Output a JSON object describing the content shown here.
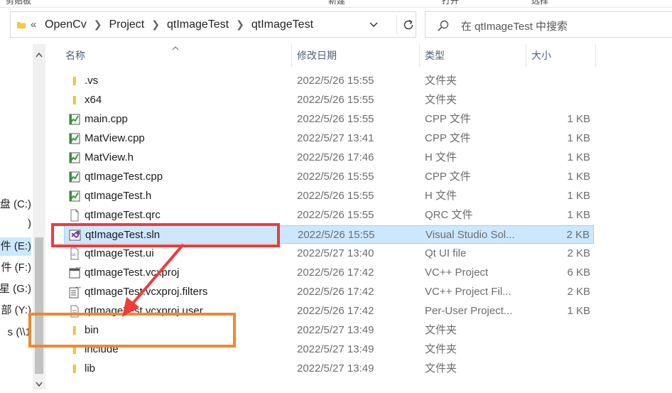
{
  "ribbon": {
    "labels": [
      "剪贴板",
      "新建",
      "打开",
      "选择"
    ]
  },
  "address_bar": {
    "overflow": "«",
    "breadcrumbs": [
      "OpenCv",
      "Project",
      "qtImageTest",
      "qtImageTest"
    ]
  },
  "search": {
    "placeholder": "在 qtImageTest 中搜索"
  },
  "nav": {
    "items": [
      {
        "label": "盘 (C:)"
      },
      {
        "label": ")"
      },
      {
        "label": "件 (E:)",
        "selected": true
      },
      {
        "label": "件 (F:)"
      },
      {
        "label": "星 (G:)"
      },
      {
        "label": "部 (Y:)"
      },
      {
        "label": "s (\\\\1"
      }
    ]
  },
  "columns": {
    "name": "名称",
    "date": "修改日期",
    "type": "类型",
    "size": "大小"
  },
  "files": [
    {
      "name": ".vs",
      "date": "2022/5/26 15:55",
      "type": "文件夹",
      "size": "",
      "icon": "folder-icon"
    },
    {
      "name": "x64",
      "date": "2022/5/26 15:55",
      "type": "文件夹",
      "size": "",
      "icon": "folder-icon"
    },
    {
      "name": "main.cpp",
      "date": "2022/5/26 15:55",
      "type": "CPP 文件",
      "size": "1 KB",
      "icon": "cpp-file-icon"
    },
    {
      "name": "MatView.cpp",
      "date": "2022/5/27 13:41",
      "type": "CPP 文件",
      "size": "1 KB",
      "icon": "cpp-file-icon"
    },
    {
      "name": "MatView.h",
      "date": "2022/5/26 17:46",
      "type": "H 文件",
      "size": "1 KB",
      "icon": "h-file-icon"
    },
    {
      "name": "qtImageTest.cpp",
      "date": "2022/5/26 15:55",
      "type": "CPP 文件",
      "size": "1 KB",
      "icon": "cpp-file-icon"
    },
    {
      "name": "qtImageTest.h",
      "date": "2022/5/26 15:55",
      "type": "H 文件",
      "size": "1 KB",
      "icon": "h-file-icon"
    },
    {
      "name": "qtImageTest.qrc",
      "date": "2022/5/26 15:55",
      "type": "QRC 文件",
      "size": "1 KB",
      "icon": "blank-file-icon"
    },
    {
      "name": "qtImageTest.sln",
      "date": "2022/5/26 15:55",
      "type": "Visual Studio Sol...",
      "size": "2 KB",
      "icon": "visual-studio-sln-icon",
      "selected": true
    },
    {
      "name": "qtImageTest.ui",
      "date": "2022/5/27 13:40",
      "type": "Qt UI file",
      "size": "2 KB",
      "icon": "qt-ui-file-icon"
    },
    {
      "name": "qtImageTest.vcxproj",
      "date": "2022/5/26 17:42",
      "type": "VC++ Project",
      "size": "6 KB",
      "icon": "vcxproj-file-icon"
    },
    {
      "name": "qtImageTest.vcxproj.filters",
      "date": "2022/5/26 17:42",
      "type": "VC++ Project Fil...",
      "size": "2 KB",
      "icon": "filters-file-icon"
    },
    {
      "name": "qtImageTest.vcxproj.user",
      "date": "2022/5/26 17:42",
      "type": "Per-User Project...",
      "size": "1 KB",
      "icon": "user-file-icon"
    },
    {
      "name": "bin",
      "date": "2022/5/27 13:49",
      "type": "文件夹",
      "size": "",
      "icon": "folder-icon"
    },
    {
      "name": "include",
      "date": "2022/5/27 13:49",
      "type": "文件夹",
      "size": "",
      "icon": "folder-icon"
    },
    {
      "name": "lib",
      "date": "2022/5/27 13:49",
      "type": "文件夹",
      "size": "",
      "icon": "folder-icon"
    }
  ],
  "colors": {
    "selection_bg": "#cce8ff",
    "selection_border": "#99d1ff",
    "annotation_red": "#ef3b3b",
    "annotation_orange": "#f0892f",
    "folder_yellow": "#f8c93f"
  }
}
